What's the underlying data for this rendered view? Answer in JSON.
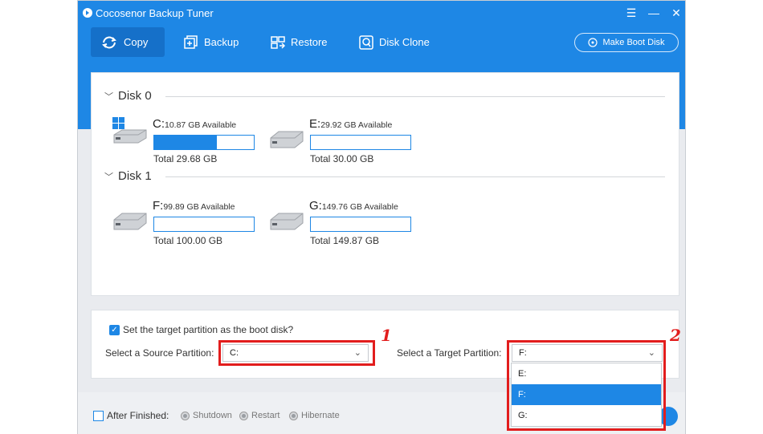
{
  "app": {
    "title": "Cocosenor Backup Tuner"
  },
  "window_controls": {
    "menu": "☰",
    "minimize": "—",
    "close": "✕"
  },
  "nav": {
    "tabs": [
      {
        "label": "Copy",
        "icon": "copy-icon",
        "active": true
      },
      {
        "label": "Backup",
        "icon": "backup-icon"
      },
      {
        "label": "Restore",
        "icon": "restore-icon"
      },
      {
        "label": "Disk Clone",
        "icon": "disk-clone-icon"
      }
    ],
    "boot_button": {
      "label": "Make Boot Disk",
      "icon": "boot-disk-icon"
    }
  },
  "disks": [
    {
      "name": "Disk 0",
      "partitions": [
        {
          "letter": "C:",
          "available": "10.87 GB Available",
          "total": "Total 29.68 GB",
          "used_fraction": 0.63,
          "icon": "windows-drive-icon"
        },
        {
          "letter": "E:",
          "available": "29.92 GB Available",
          "total": "Total 30.00 GB",
          "used_fraction": 0.0,
          "icon": "drive-icon"
        }
      ]
    },
    {
      "name": "Disk 1",
      "partitions": [
        {
          "letter": "F:",
          "available": "99.89 GB Available",
          "total": "Total 100.00 GB",
          "used_fraction": 0.0,
          "icon": "drive-icon"
        },
        {
          "letter": "G:",
          "available": "149.76 GB Available",
          "total": "Total 149.87 GB",
          "used_fraction": 0.0,
          "icon": "drive-icon"
        }
      ]
    }
  ],
  "options": {
    "boot_checkbox_label": "Set the target partition as the boot disk?",
    "boot_checked": true,
    "source_label": "Select a Source Partition:",
    "source_value": "C:",
    "target_label": "Select a Target Partition:",
    "target_value": "F:",
    "target_options": [
      "E:",
      "F:",
      "G:"
    ],
    "target_selected_index": 1
  },
  "annotations": {
    "marker_1": "1",
    "marker_2": "2"
  },
  "footer": {
    "after_finished_label": "After Finished:",
    "radios": [
      "Shutdown",
      "Restart",
      "Hibernate"
    ]
  },
  "colors": {
    "accent": "#1e87e5",
    "annotation_red": "#e21d1d"
  }
}
